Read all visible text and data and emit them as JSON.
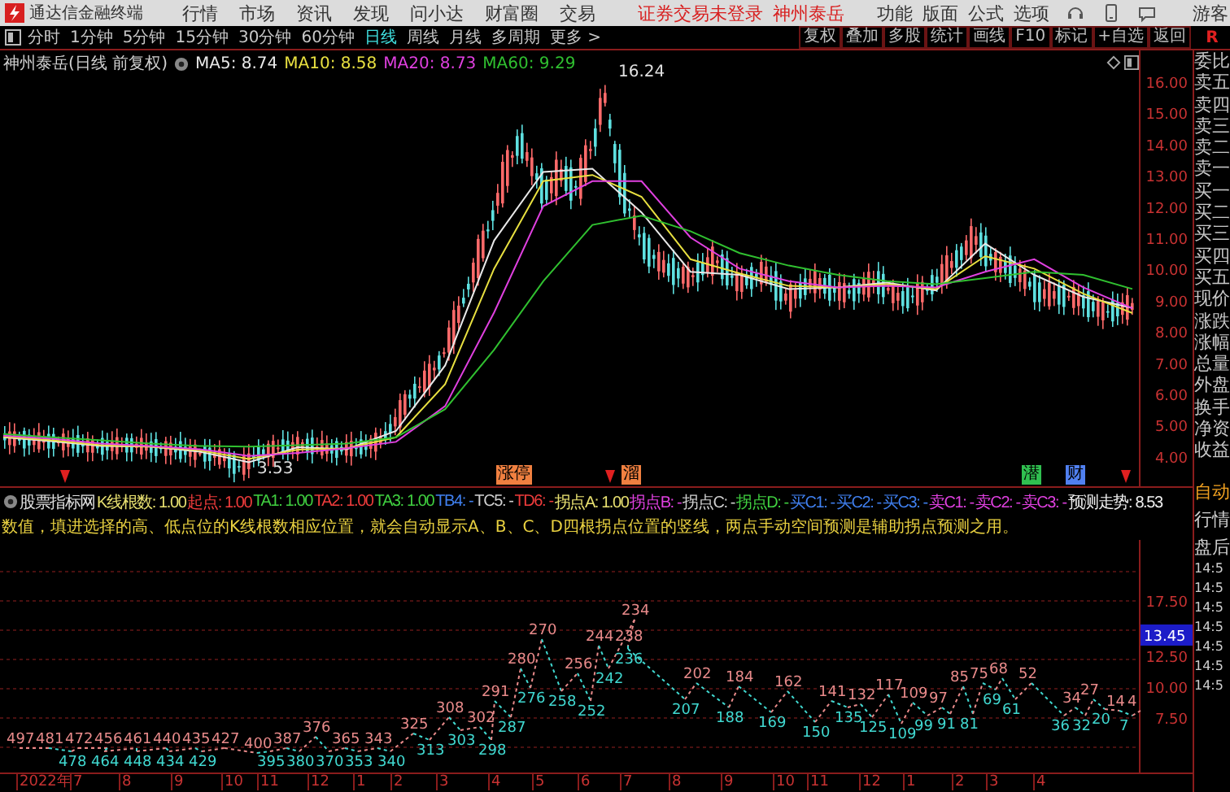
{
  "title_bar": {
    "app_name": "通达信金融终端",
    "menus": [
      "行情",
      "市场",
      "资讯",
      "发现",
      "问小达",
      "财富圈",
      "交易"
    ],
    "login_notice": "证券交易未登录",
    "stock_link": "神州泰岳",
    "tools": [
      "功能",
      "版面",
      "公式",
      "选项"
    ],
    "user": "游客"
  },
  "period_tabs": [
    {
      "label": "分时",
      "selected": false
    },
    {
      "label": "1分钟",
      "selected": false
    },
    {
      "label": "5分钟",
      "selected": false
    },
    {
      "label": "15分钟",
      "selected": false
    },
    {
      "label": "30分钟",
      "selected": false
    },
    {
      "label": "60分钟",
      "selected": false
    },
    {
      "label": "日线",
      "selected": true
    },
    {
      "label": "周线",
      "selected": false
    },
    {
      "label": "月线",
      "selected": false
    },
    {
      "label": "多周期",
      "selected": false
    },
    {
      "label": "更多 >",
      "selected": false
    }
  ],
  "toolbar_buttons": [
    "复权",
    "叠加",
    "多股",
    "统计",
    "画线",
    "F10",
    "标记",
    "+自选",
    "返回"
  ],
  "toolbar_badge": "R",
  "main_chart": {
    "title": "神州泰岳(日线 前复权)",
    "ma": [
      {
        "label": "MA5: 8.74",
        "color": "#e8e8e8"
      },
      {
        "label": "MA10: 8.58",
        "color": "#e8e040"
      },
      {
        "label": "MA20: 8.73",
        "color": "#e040e0"
      },
      {
        "label": "MA60: 9.29",
        "color": "#30c030"
      }
    ],
    "chart_data": {
      "type": "line",
      "ylim": [
        3.03,
        16.99
      ],
      "yticks": [
        {
          "value": 16,
          "label": "16.00"
        },
        {
          "value": 15,
          "label": "15.00"
        },
        {
          "value": 14,
          "label": "14.00"
        },
        {
          "value": 13,
          "label": "13.00"
        },
        {
          "value": 12,
          "label": "12.00"
        },
        {
          "value": 11,
          "label": "11.00"
        },
        {
          "value": 10,
          "label": "10.00"
        },
        {
          "value": 9,
          "label": "9.00"
        },
        {
          "value": 8,
          "label": "8.00"
        },
        {
          "value": 7,
          "label": "7.00"
        },
        {
          "value": 6,
          "label": "6.00"
        },
        {
          "value": 5,
          "label": "5.00"
        },
        {
          "value": 4,
          "label": "4.00"
        }
      ],
      "series": [
        {
          "color": "#e8e8e8",
          "values": [
            4.6,
            4.47,
            4.32,
            4.3,
            4.14,
            3.8,
            4.28,
            4.22,
            4.8,
            6.9,
            10.9,
            13.1,
            13.2,
            11.8,
            9.9,
            9.8,
            9.35,
            9.4,
            9.55,
            9.3,
            10.8,
            9.8,
            9.1,
            8.74
          ]
        },
        {
          "color": "#e8e040",
          "values": [
            4.62,
            4.5,
            4.35,
            4.3,
            4.18,
            3.9,
            4.2,
            4.25,
            4.6,
            6.3,
            10.0,
            12.8,
            13.0,
            12.3,
            10.3,
            9.85,
            9.45,
            9.4,
            9.5,
            9.35,
            10.4,
            10.0,
            9.2,
            8.58
          ]
        },
        {
          "color": "#e040e0",
          "values": [
            4.65,
            4.55,
            4.4,
            4.32,
            4.22,
            4.0,
            4.1,
            4.25,
            4.45,
            5.6,
            8.6,
            12.0,
            12.8,
            12.8,
            11.0,
            10.0,
            9.6,
            9.4,
            9.45,
            9.4,
            9.9,
            10.3,
            9.4,
            8.73
          ]
        },
        {
          "color": "#30c030",
          "values": [
            4.7,
            4.6,
            4.5,
            4.4,
            4.32,
            4.3,
            4.35,
            4.4,
            4.6,
            5.5,
            7.4,
            9.6,
            11.4,
            11.7,
            11.2,
            10.5,
            10.1,
            9.8,
            9.6,
            9.5,
            9.7,
            9.9,
            9.8,
            9.35
          ]
        }
      ],
      "annotations": [
        "16.24",
        "3.53"
      ]
    },
    "signals": [
      {
        "text": "涨停",
        "color": "#f08040"
      },
      {
        "text": "溜",
        "color": "#f08040"
      },
      {
        "text": "潜",
        "color": "#30c050"
      },
      {
        "text": "财",
        "color": "#5080f0"
      }
    ]
  },
  "indicator": {
    "name": "股票指标网",
    "params": [
      {
        "text": "K线根数: 1.00",
        "color": "#e8e070"
      },
      {
        "text": "起点: 1.00",
        "color": "#f03c3c"
      },
      {
        "text": "TA1: 1.00",
        "color": "#40d040"
      },
      {
        "text": "TA2: 1.00",
        "color": "#f03c3c"
      },
      {
        "text": "TA3: 1.00",
        "color": "#40d040"
      },
      {
        "text": "TB4: -",
        "color": "#4080f0"
      },
      {
        "text": "TC5: -",
        "color": "#d0d0d0"
      },
      {
        "text": "TD6: -",
        "color": "#f03c3c"
      },
      {
        "text": "拐点A: 1.00",
        "color": "#e8e070"
      },
      {
        "text": "拐点B: -",
        "color": "#e040e0"
      },
      {
        "text": "拐点C: -",
        "color": "#d0d0d0"
      },
      {
        "text": "拐点D: -",
        "color": "#40d040"
      },
      {
        "text": "买C1: -",
        "color": "#4080f0"
      },
      {
        "text": "买C2: -",
        "color": "#4080f0"
      },
      {
        "text": "买C3: -",
        "color": "#4080f0"
      },
      {
        "text": "卖C1: -",
        "color": "#e040e0"
      },
      {
        "text": "卖C2: -",
        "color": "#e040e0"
      },
      {
        "text": "卖C3: -",
        "color": "#e040e0"
      },
      {
        "text": "预测走势: 8.53",
        "color": "#f0f0f0"
      }
    ],
    "description": "数值，填进选择的高、低点位的K线根数相应位置，就会自动显示A、B、C、D四根拐点位置的竖线，两点手动空间预测是辅助拐点预测之用。"
  },
  "lower_chart": {
    "y_axis": [
      "17.50",
      "12.50",
      "10.00",
      "7.50"
    ],
    "current_value": "13.45",
    "labels": [
      {
        "text": "497",
        "kind": "peak"
      },
      {
        "text": "481",
        "kind": "peak"
      },
      {
        "text": "478",
        "kind": "trough"
      },
      {
        "text": "472",
        "kind": "peak"
      },
      {
        "text": "456",
        "kind": "peak"
      },
      {
        "text": "464",
        "kind": "trough"
      },
      {
        "text": "461",
        "kind": "peak"
      },
      {
        "text": "448",
        "kind": "trough"
      },
      {
        "text": "440",
        "kind": "peak"
      },
      {
        "text": "434",
        "kind": "trough"
      },
      {
        "text": "435",
        "kind": "peak"
      },
      {
        "text": "429",
        "kind": "trough"
      },
      {
        "text": "427",
        "kind": "peak"
      },
      {
        "text": "400",
        "kind": "peak"
      },
      {
        "text": "395",
        "kind": "trough"
      },
      {
        "text": "387",
        "kind": "peak"
      },
      {
        "text": "380",
        "kind": "trough"
      },
      {
        "text": "376",
        "kind": "peak"
      },
      {
        "text": "370",
        "kind": "trough"
      },
      {
        "text": "365",
        "kind": "peak"
      },
      {
        "text": "353",
        "kind": "trough"
      },
      {
        "text": "343",
        "kind": "peak"
      },
      {
        "text": "340",
        "kind": "trough"
      },
      {
        "text": "325",
        "kind": "peak"
      },
      {
        "text": "313",
        "kind": "trough"
      },
      {
        "text": "308",
        "kind": "peak"
      },
      {
        "text": "303",
        "kind": "trough"
      },
      {
        "text": "302",
        "kind": "peak"
      },
      {
        "text": "298",
        "kind": "trough"
      },
      {
        "text": "291",
        "kind": "peak"
      },
      {
        "text": "287",
        "kind": "trough"
      },
      {
        "text": "280",
        "kind": "peak"
      },
      {
        "text": "276",
        "kind": "trough"
      },
      {
        "text": "270",
        "kind": "peak"
      },
      {
        "text": "258",
        "kind": "trough"
      },
      {
        "text": "256",
        "kind": "peak"
      },
      {
        "text": "252",
        "kind": "trough"
      },
      {
        "text": "244",
        "kind": "peak"
      },
      {
        "text": "242",
        "kind": "trough"
      },
      {
        "text": "234",
        "kind": "peak"
      },
      {
        "text": "238",
        "kind": "peak"
      },
      {
        "text": "236",
        "kind": "trough"
      },
      {
        "text": "207",
        "kind": "trough"
      },
      {
        "text": "202",
        "kind": "peak"
      },
      {
        "text": "188",
        "kind": "trough"
      },
      {
        "text": "184",
        "kind": "peak"
      },
      {
        "text": "169",
        "kind": "trough"
      },
      {
        "text": "162",
        "kind": "peak"
      },
      {
        "text": "150",
        "kind": "trough"
      },
      {
        "text": "141",
        "kind": "peak"
      },
      {
        "text": "135",
        "kind": "trough"
      },
      {
        "text": "132",
        "kind": "peak"
      },
      {
        "text": "125",
        "kind": "trough"
      },
      {
        "text": "117",
        "kind": "peak"
      },
      {
        "text": "109",
        "kind": "trough"
      },
      {
        "text": "109",
        "kind": "peak"
      },
      {
        "text": "99",
        "kind": "trough"
      },
      {
        "text": "97",
        "kind": "peak"
      },
      {
        "text": "91",
        "kind": "trough"
      },
      {
        "text": "85",
        "kind": "peak"
      },
      {
        "text": "81",
        "kind": "trough"
      },
      {
        "text": "75",
        "kind": "peak"
      },
      {
        "text": "69",
        "kind": "trough"
      },
      {
        "text": "68",
        "kind": "peak"
      },
      {
        "text": "61",
        "kind": "trough"
      },
      {
        "text": "52",
        "kind": "peak"
      },
      {
        "text": "36",
        "kind": "trough"
      },
      {
        "text": "34",
        "kind": "peak"
      },
      {
        "text": "32",
        "kind": "trough"
      },
      {
        "text": "27",
        "kind": "peak"
      },
      {
        "text": "20",
        "kind": "trough"
      },
      {
        "text": "14",
        "kind": "peak"
      },
      {
        "text": "7",
        "kind": "trough"
      },
      {
        "text": "4",
        "kind": "peak"
      }
    ]
  },
  "x_axis": [
    "2022年",
    "7",
    "8",
    "9",
    "10",
    "11",
    "12",
    "1",
    "2",
    "3",
    "4",
    "5",
    "6",
    "7",
    "8",
    "9",
    "10",
    "11",
    "12",
    "1",
    "2",
    "3",
    "4"
  ],
  "side_panel": {
    "quote_labels": [
      "委比",
      "卖五",
      "卖四",
      "卖三",
      "卖二",
      "卖一",
      "买一",
      "买二",
      "买三",
      "买四",
      "买五",
      "现价",
      "涨跌",
      "涨幅",
      "总量",
      "外盘",
      "换手",
      "净资",
      "收益"
    ],
    "modes": [
      "自动",
      "行情",
      "盘后"
    ],
    "times": [
      "14:5",
      "14:5",
      "14:5",
      "14:5",
      "14:5",
      "14:5",
      "14:5"
    ]
  }
}
